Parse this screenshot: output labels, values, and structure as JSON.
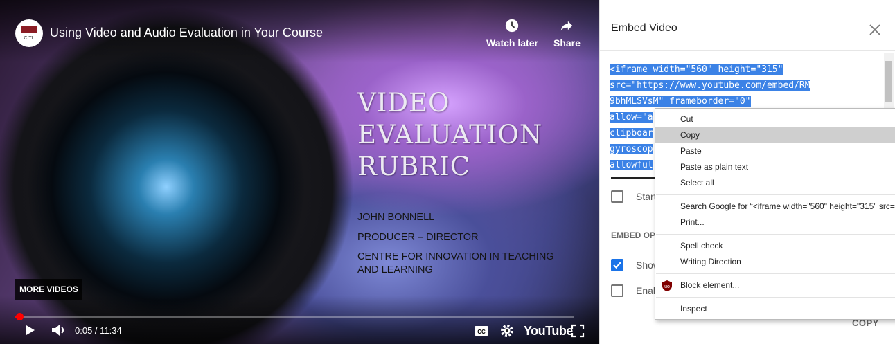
{
  "player": {
    "channel_logo_text": "CITL",
    "title": "Using Video and Audio Evaluation in Your Course",
    "watch_later": "Watch later",
    "share": "Share",
    "slide": {
      "title_lines": [
        "VIDEO",
        "EVALUATION",
        "RUBRIC"
      ],
      "name": "JOHN BONNELL",
      "role": "PRODUCER – DIRECTOR",
      "org_line1": "CENTRE FOR INNOVATION IN TEACHING",
      "org_line2": "AND LEARNING"
    },
    "more_videos": "MORE VIDEOS",
    "time": "0:05 / 11:34",
    "progress_fraction": 0.0072,
    "youtube_logo": "YouTube",
    "icons": [
      "play-icon",
      "volume-icon",
      "cc-icon",
      "gear-icon",
      "fullscreen-icon",
      "clock-icon",
      "share-icon"
    ]
  },
  "embed": {
    "header": "Embed Video",
    "code_lines": [
      "<iframe width=\"560\" height=\"315\"",
      "src=\"https://www.youtube.com/embed/RM",
      "9bhMLSVsM\" frameborder=\"0\"",
      "allow=\"a",
      "clipboar",
      "gyroscop",
      "allowful"
    ],
    "start_at_label": "Start",
    "embed_options_label": "EMBED OPT",
    "show_label": "Show",
    "enable_label": "Enab",
    "copy_button": "COPY"
  },
  "context_menu": {
    "cut": "Cut",
    "copy": "Copy",
    "paste": "Paste",
    "paste_plain": "Paste as plain text",
    "select_all": "Select all",
    "search_google": "Search Google for “<iframe width=\"560\" height=\"315\" src=",
    "print": "Print...",
    "spell_check": "Spell check",
    "writing_direction": "Writing Direction",
    "block_element": "Block element...",
    "inspect": "Inspect"
  },
  "colors": {
    "selection": "#3b82e6",
    "progress": "#ff0000",
    "checkbox_checked": "#1a73e8",
    "menu_highlight": "#cfcfcf"
  }
}
